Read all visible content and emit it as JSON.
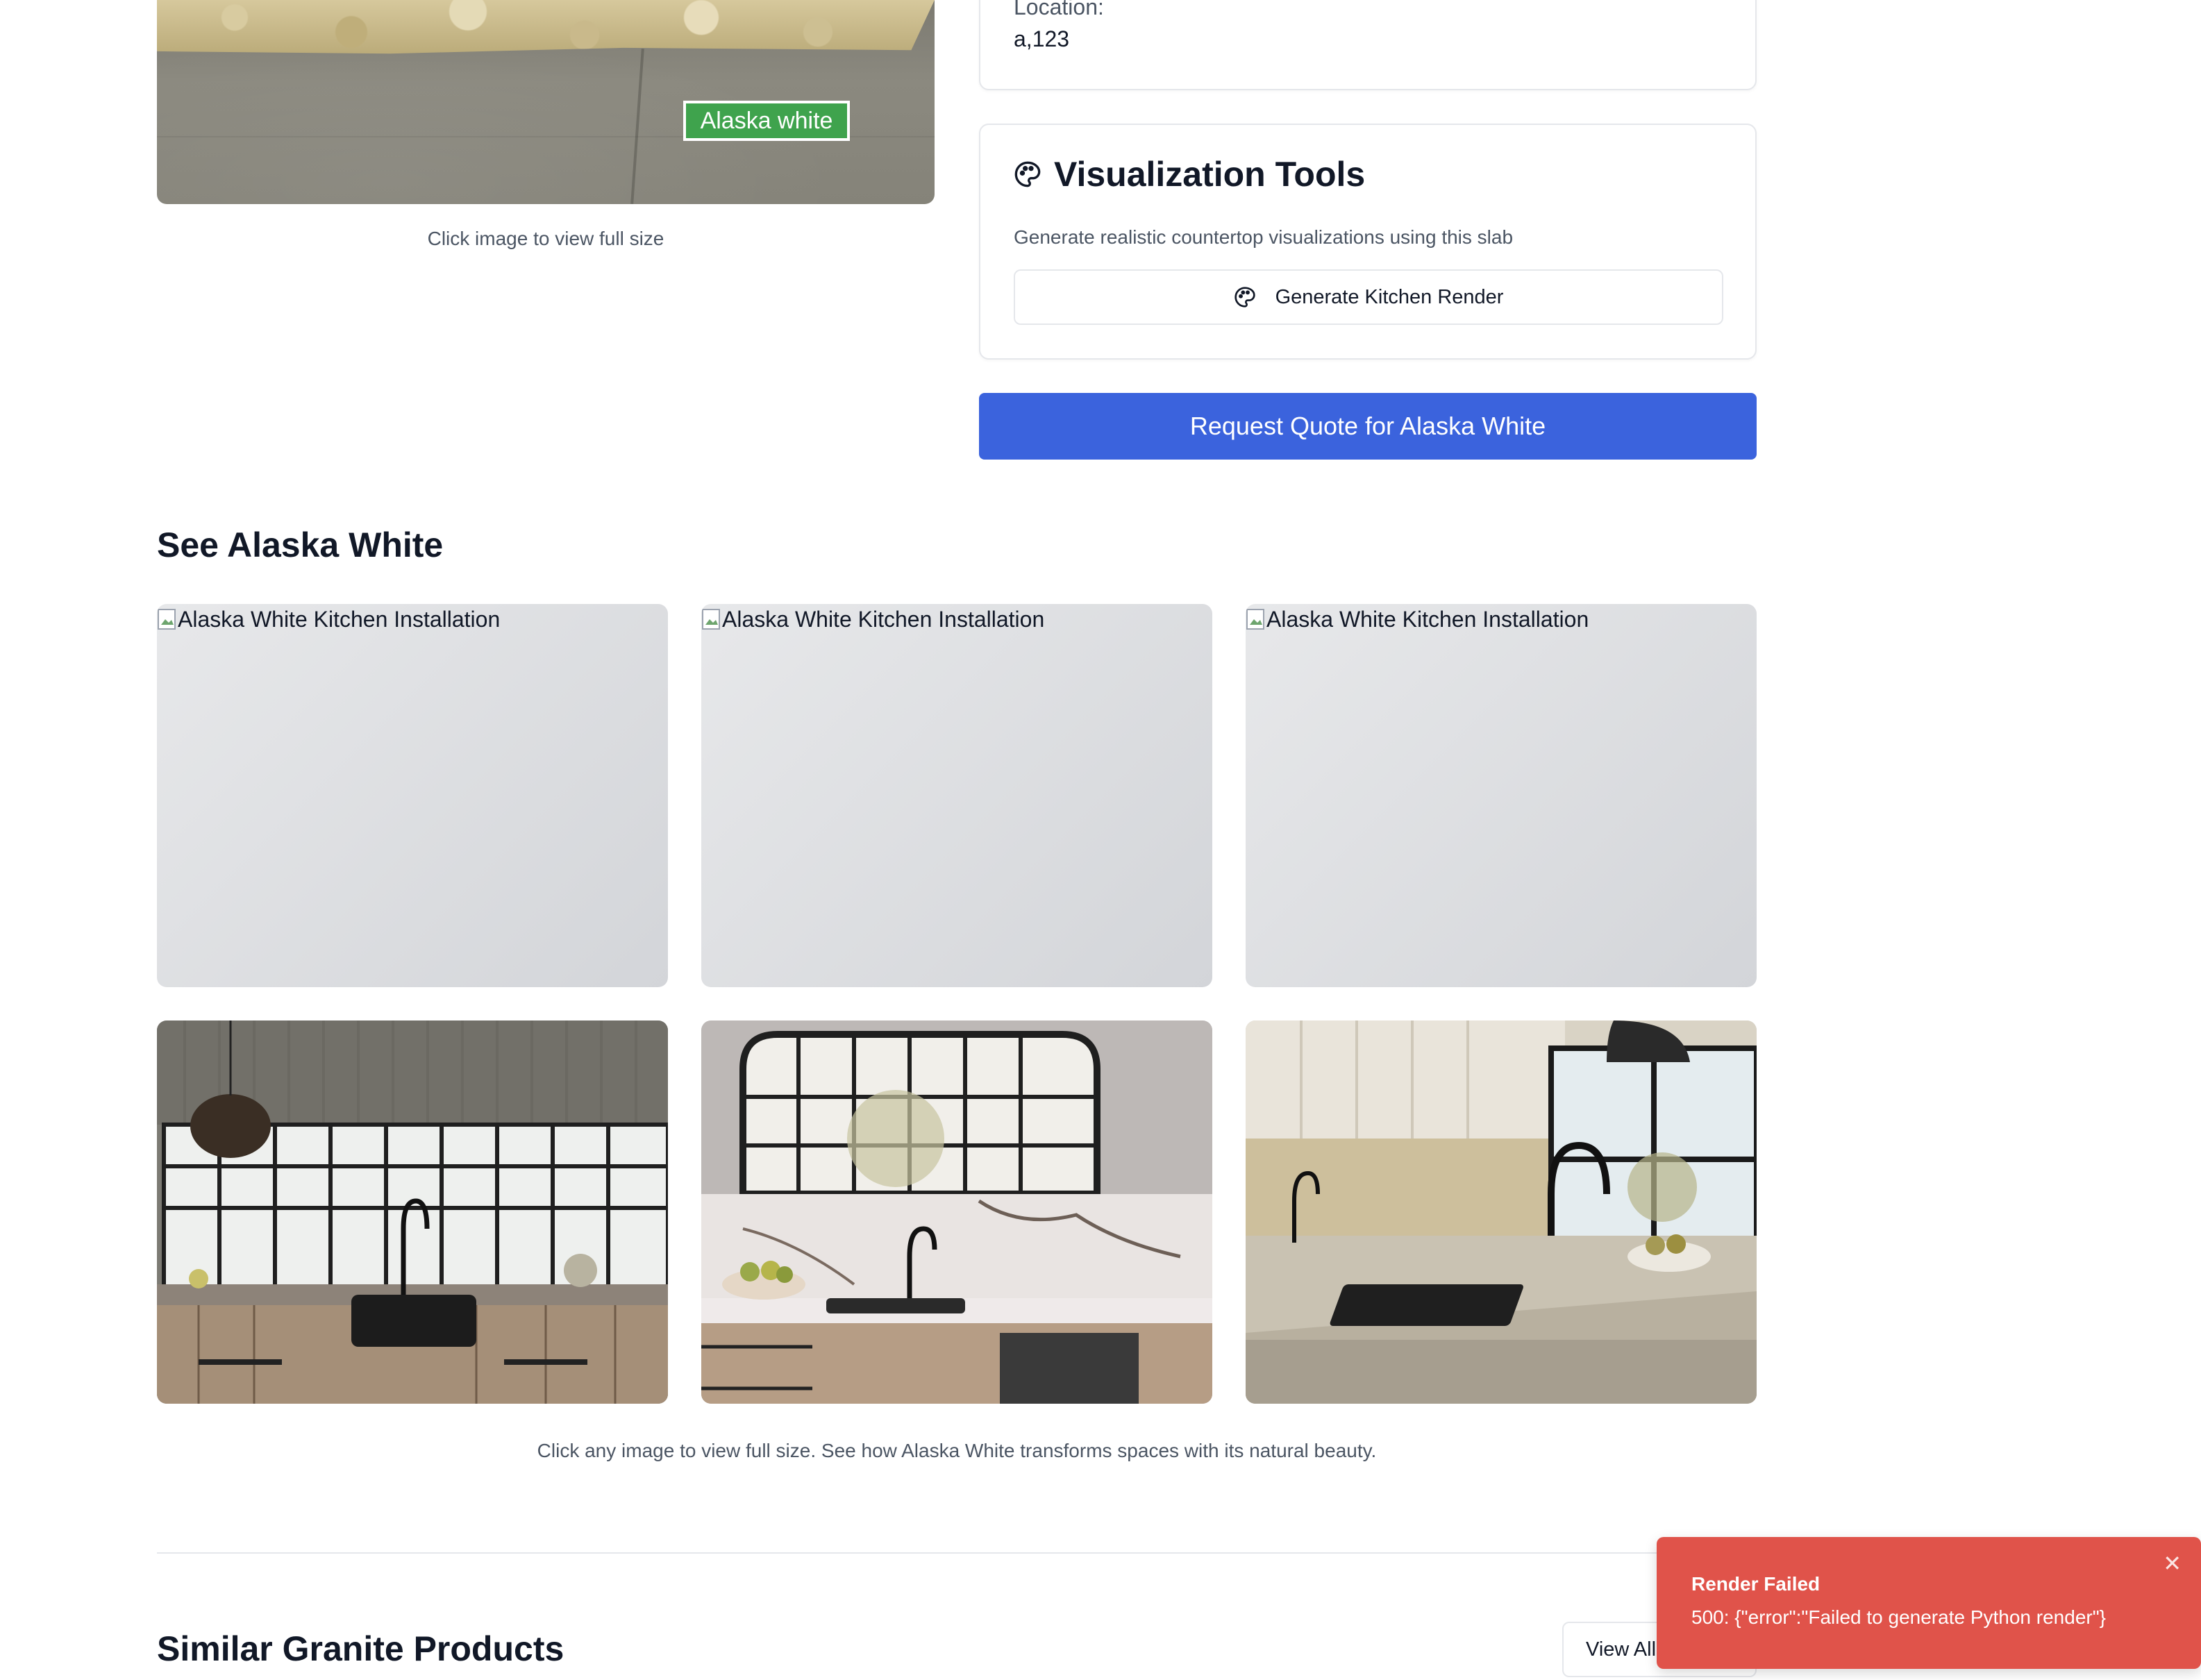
{
  "slab": {
    "tag": "Alaska white",
    "hint": "Click image to view full size"
  },
  "location": {
    "label": "Location:",
    "value": "a,123"
  },
  "visualization": {
    "icon": "palette-icon",
    "title": "Visualization Tools",
    "description": "Generate realistic countertop visualizations using this slab",
    "button_label": "Generate Kitchen Render"
  },
  "quote_button": "Request Quote for Alaska White",
  "gallery": {
    "title": "See Alaska White",
    "broken_alt": [
      "Alaska White Kitchen Installation",
      "Alaska White Kitchen Installation",
      "Alaska White Kitchen Installation"
    ],
    "caption": "Click any image to view full size. See how Alaska White transforms spaces with its natural beauty."
  },
  "similar": {
    "title": "Similar Granite Products",
    "view_all": "View All"
  },
  "toast": {
    "title": "Render Failed",
    "message": "500: {\"error\":\"Failed to generate Python render\"}"
  },
  "colors": {
    "primary": "#3b63dd",
    "tag_green": "#3fa34d",
    "toast_red": "#e0534a"
  }
}
